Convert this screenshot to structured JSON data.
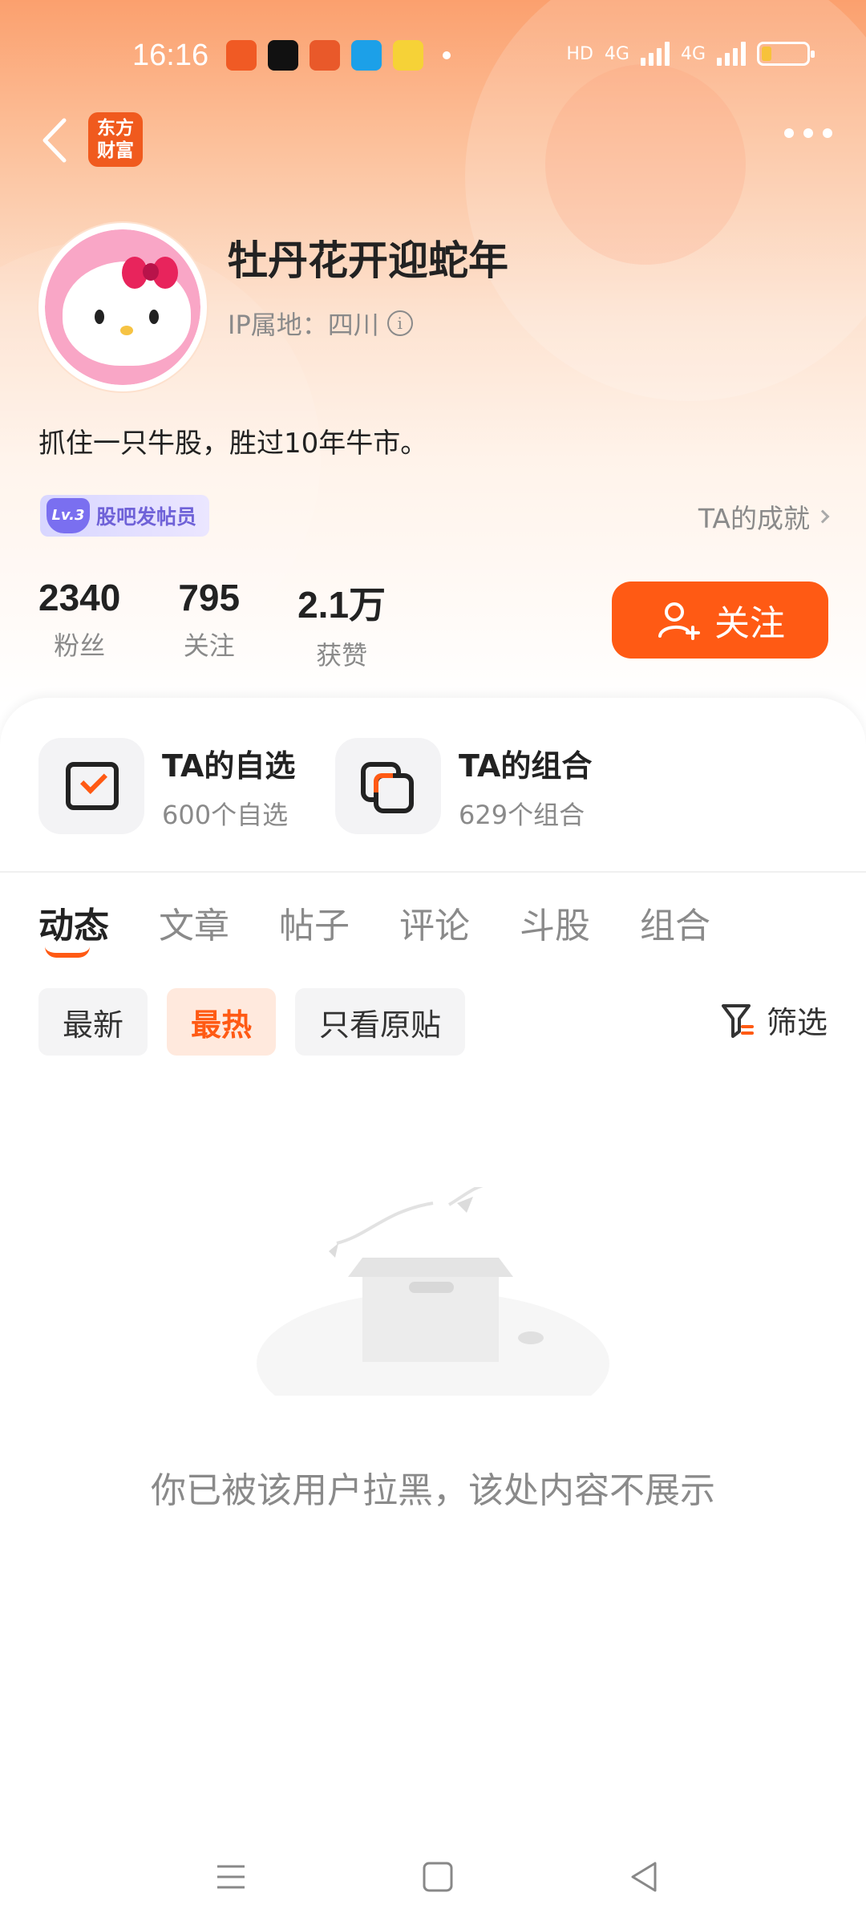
{
  "status_bar": {
    "time": "16:16",
    "network_1": "4G",
    "network_2": "4G",
    "hd_label": "HD"
  },
  "header": {
    "app_logo_line1": "东方",
    "app_logo_line2": "财富"
  },
  "profile": {
    "nickname": "牡丹花开迎蛇年",
    "ip_location": "IP属地：四川",
    "bio": "抓住一只牛股，胜过10年牛市。",
    "badge_level": "Lv.3",
    "badge_label": "股吧发帖员",
    "achievements_link": "TA的成就",
    "stats": [
      {
        "value": "2340",
        "label": "粉丝"
      },
      {
        "value": "795",
        "label": "关注"
      },
      {
        "value": "2.1万",
        "label": "获赞"
      }
    ],
    "follow_label": "关注"
  },
  "quick_links": [
    {
      "title": "TA的自选",
      "subtitle": "600个自选",
      "icon": "watchlist-icon"
    },
    {
      "title": "TA的组合",
      "subtitle": "629个组合",
      "icon": "portfolio-icon"
    }
  ],
  "tabs": [
    "动态",
    "文章",
    "帖子",
    "评论",
    "斗股",
    "组合"
  ],
  "active_tab": "动态",
  "filters": {
    "chips": [
      "最新",
      "最热",
      "只看原贴"
    ],
    "active_chip": "最热",
    "filter_label": "筛选"
  },
  "empty_state": {
    "message": "你已被该用户拉黑，该处内容不展示"
  },
  "colors": {
    "accent": "#ff5a14",
    "header_gradient_top": "#fba06e",
    "muted_text": "#8a8a8a"
  }
}
